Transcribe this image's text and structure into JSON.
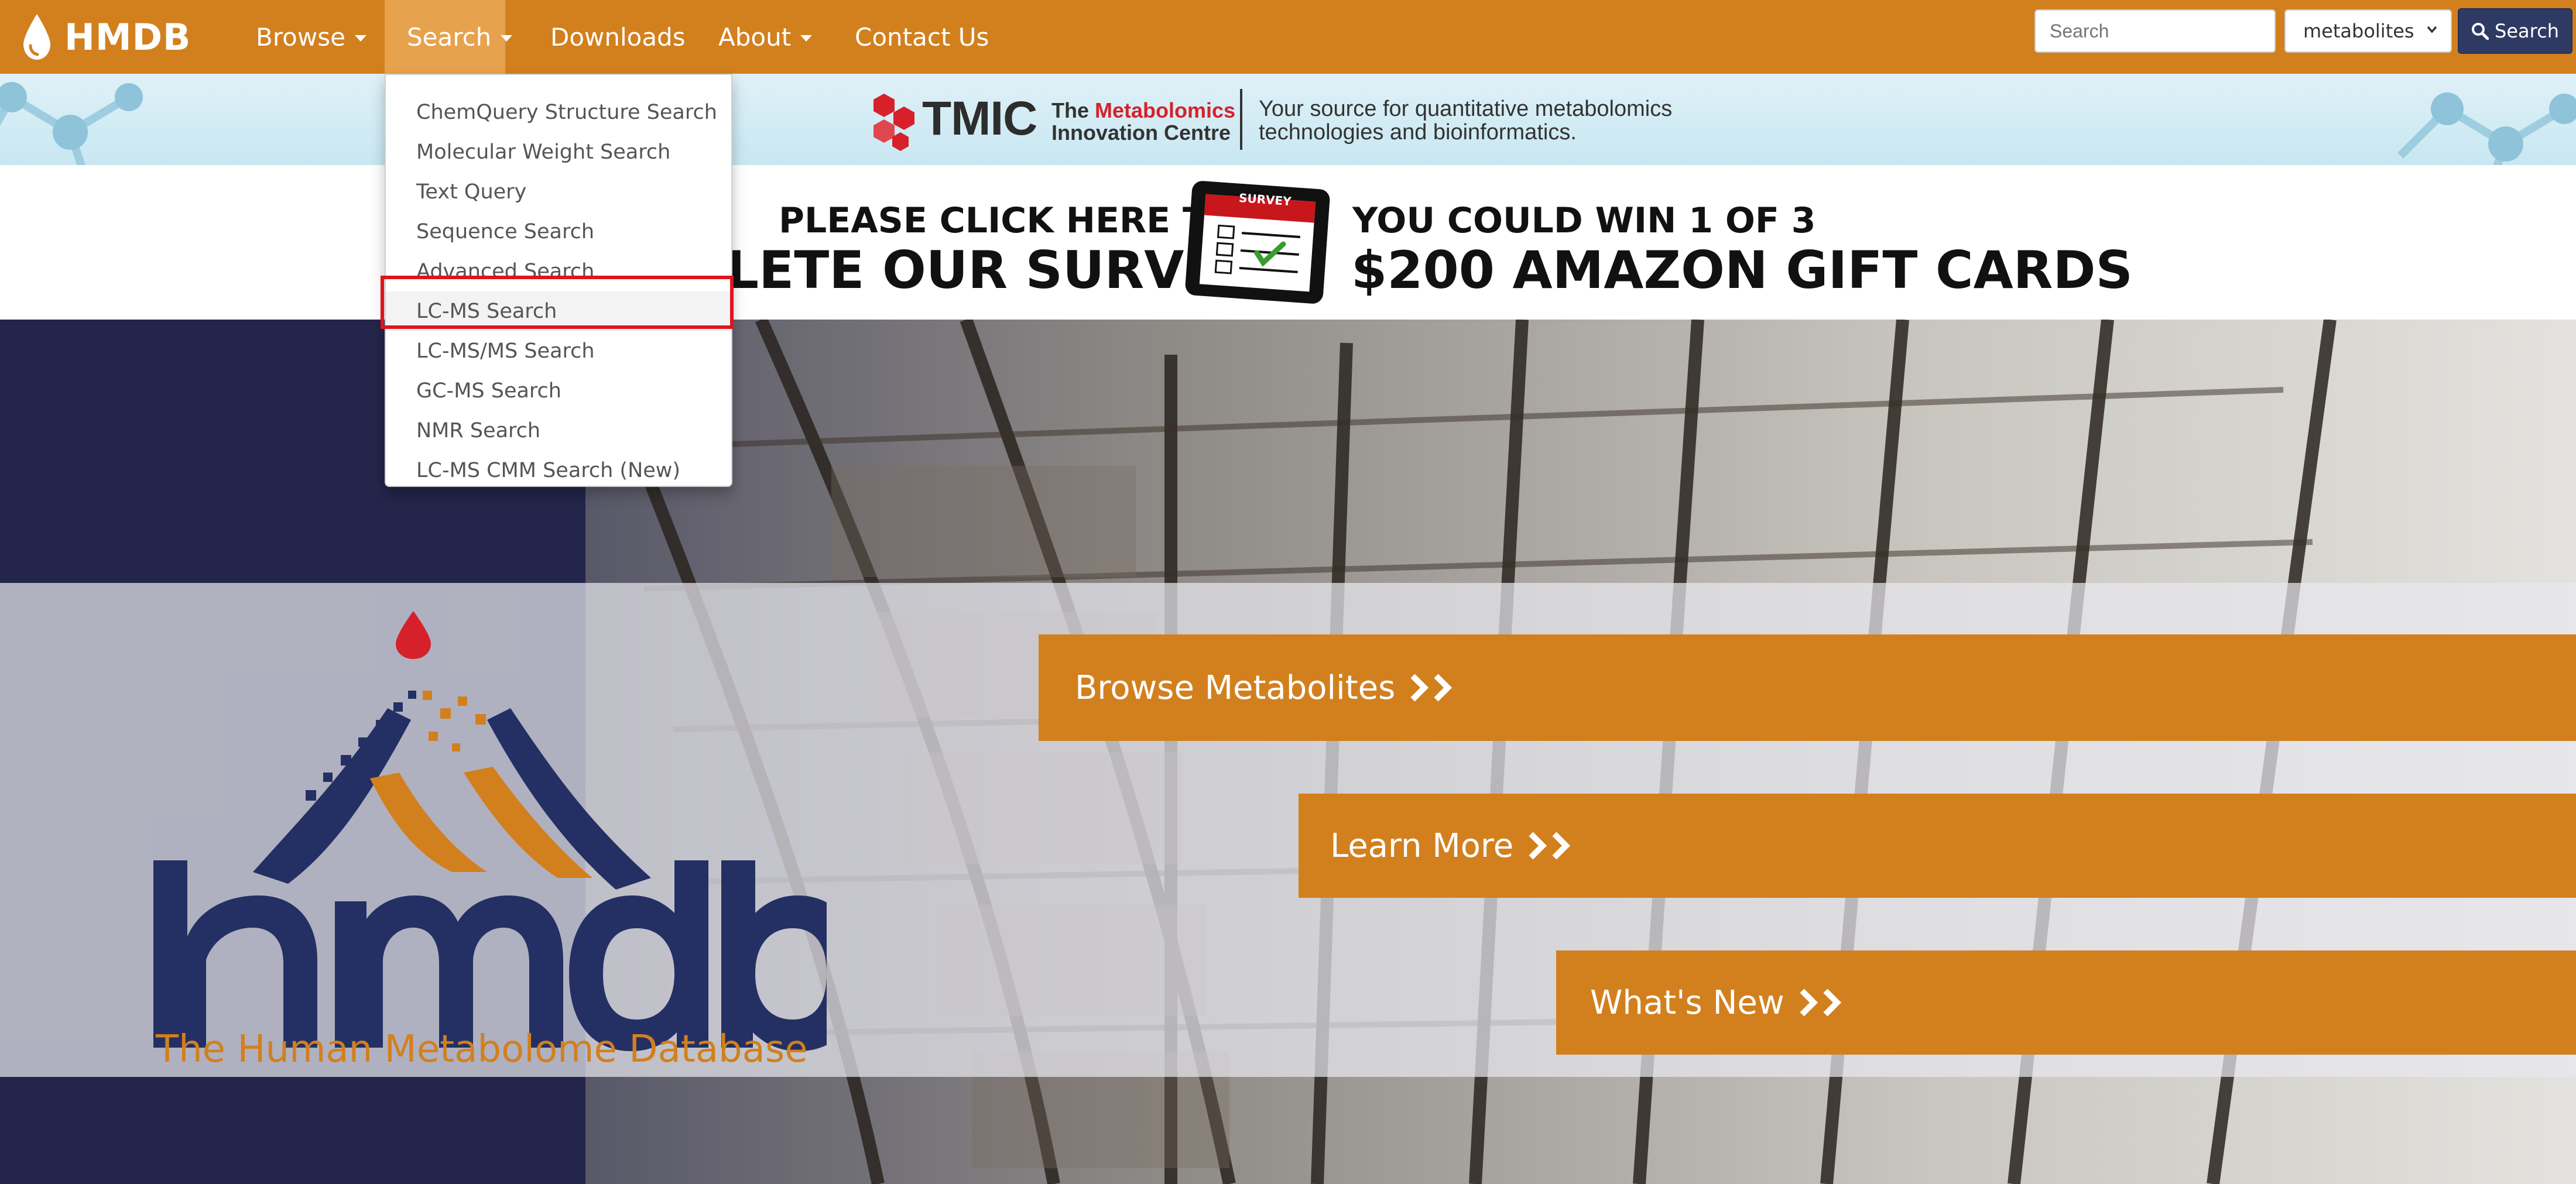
{
  "brand": {
    "name": "HMDB",
    "logo_icon": "drop-icon"
  },
  "nav": {
    "items": [
      {
        "label": "Browse",
        "has_caret": true
      },
      {
        "label": "Search",
        "has_caret": true
      },
      {
        "label": "Downloads",
        "has_caret": false
      },
      {
        "label": "About",
        "has_caret": true
      },
      {
        "label": "Contact Us",
        "has_caret": false
      }
    ],
    "search_placeholder": "Search",
    "select_value": "metabolites",
    "search_button": "Search"
  },
  "search_menu": {
    "items": [
      "ChemQuery Structure Search",
      "Molecular Weight Search",
      "Text Query",
      "Sequence Search",
      "Advanced Search",
      "LC-MS Search",
      "LC-MS/MS Search",
      "GC-MS Search",
      "NMR Search",
      "LC-MS CMM Search (New)"
    ],
    "highlighted_index": 5
  },
  "tmic_banner": {
    "logo": "TMIC",
    "sub_line1_prefix": "The ",
    "sub_line1_red": "Metabolomics",
    "sub_line2": "Innovation Centre",
    "tagline_line1": "Your source for quantitative metabolomics",
    "tagline_line2": "technologies and bioinformatics."
  },
  "survey": {
    "left_line1": "PLEASE CLICK HERE TO",
    "left_line2": "LETE OUR SURVEY",
    "tablet_label": "SURVEY",
    "right_line1": "YOU COULD WIN 1 OF 3",
    "right_line2": "$200 AMAZON GIFT CARDS"
  },
  "hero": {
    "browse": "Browse Metabolites",
    "learn": "Learn More",
    "whats_new": "What's New",
    "logo_word": "hmdb",
    "logo_tagline": "The Human Metabolome Database"
  },
  "colors": {
    "brand_orange": "#d2801e",
    "navy": "#243063",
    "highlight_red": "#e0141c"
  }
}
